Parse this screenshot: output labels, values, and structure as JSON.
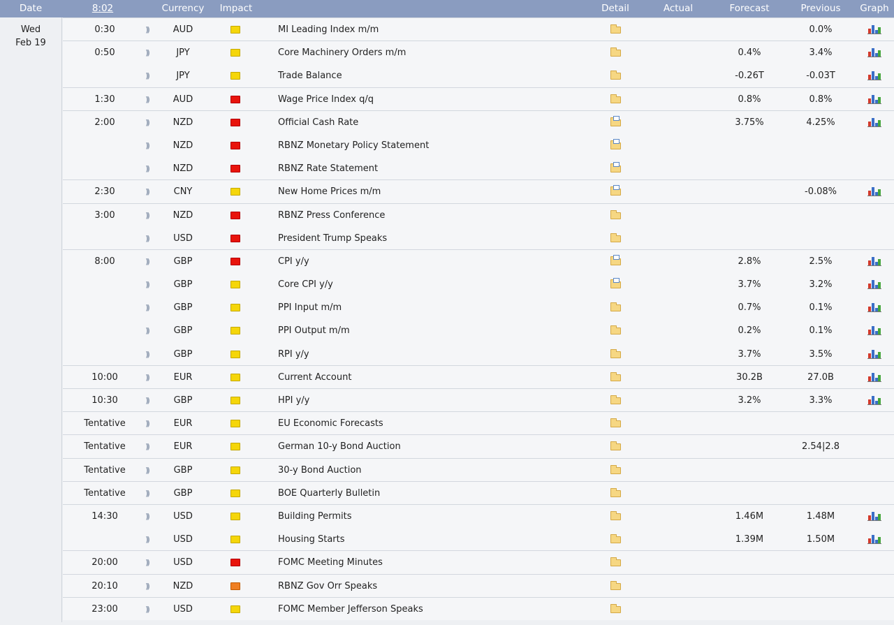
{
  "header": {
    "date": "Date",
    "clock": "8:02",
    "currency": "Currency",
    "impact": "Impact",
    "detail": "Detail",
    "actual": "Actual",
    "forecast": "Forecast",
    "previous": "Previous",
    "graph": "Graph"
  },
  "date": {
    "day": "Wed",
    "date": "Feb 19"
  },
  "impact_colors": {
    "high": "#e8140c",
    "medium": "#ef7f22",
    "low": "#f5d60a"
  },
  "events": [
    {
      "time": "0:30",
      "currency": "AUD",
      "impact": "low",
      "event": "MI Leading Index m/m",
      "detail_icon": "folder-icon",
      "actual": "",
      "forecast": "",
      "previous": "0.0%",
      "graph": true,
      "group_start": true
    },
    {
      "time": "0:50",
      "currency": "JPY",
      "impact": "low",
      "event": "Core Machinery Orders m/m",
      "detail_icon": "folder-icon",
      "actual": "",
      "forecast": "0.4%",
      "previous": "3.4%",
      "graph": true,
      "group_start": true
    },
    {
      "time": "",
      "currency": "JPY",
      "impact": "low",
      "event": "Trade Balance",
      "detail_icon": "folder-icon",
      "actual": "",
      "forecast": "-0.26T",
      "previous": "-0.03T",
      "graph": true,
      "group_start": false
    },
    {
      "time": "1:30",
      "currency": "AUD",
      "impact": "high",
      "event": "Wage Price Index q/q",
      "detail_icon": "folder-icon",
      "actual": "",
      "forecast": "0.8%",
      "previous": "0.8%",
      "graph": true,
      "group_start": true
    },
    {
      "time": "2:00",
      "currency": "NZD",
      "impact": "high",
      "event": "Official Cash Rate",
      "detail_icon": "news-folder-icon",
      "actual": "",
      "forecast": "3.75%",
      "previous": "4.25%",
      "graph": true,
      "group_start": true
    },
    {
      "time": "",
      "currency": "NZD",
      "impact": "high",
      "event": "RBNZ Monetary Policy Statement",
      "detail_icon": "news-folder-icon",
      "actual": "",
      "forecast": "",
      "previous": "",
      "graph": false,
      "group_start": false
    },
    {
      "time": "",
      "currency": "NZD",
      "impact": "high",
      "event": "RBNZ Rate Statement",
      "detail_icon": "news-folder-icon",
      "actual": "",
      "forecast": "",
      "previous": "",
      "graph": false,
      "group_start": false
    },
    {
      "time": "2:30",
      "currency": "CNY",
      "impact": "low",
      "event": "New Home Prices m/m",
      "detail_icon": "news-folder-icon",
      "actual": "",
      "forecast": "",
      "previous": "-0.08%",
      "graph": true,
      "group_start": true
    },
    {
      "time": "3:00",
      "currency": "NZD",
      "impact": "high",
      "event": "RBNZ Press Conference",
      "detail_icon": "folder-icon",
      "actual": "",
      "forecast": "",
      "previous": "",
      "graph": false,
      "group_start": true
    },
    {
      "time": "",
      "currency": "USD",
      "impact": "high",
      "event": "President Trump Speaks",
      "detail_icon": "folder-icon",
      "actual": "",
      "forecast": "",
      "previous": "",
      "graph": false,
      "group_start": false
    },
    {
      "time": "8:00",
      "currency": "GBP",
      "impact": "high",
      "event": "CPI y/y",
      "detail_icon": "news-folder-icon",
      "actual": "",
      "forecast": "2.8%",
      "previous": "2.5%",
      "graph": true,
      "group_start": true
    },
    {
      "time": "",
      "currency": "GBP",
      "impact": "low",
      "event": "Core CPI y/y",
      "detail_icon": "news-folder-icon",
      "actual": "",
      "forecast": "3.7%",
      "previous": "3.2%",
      "graph": true,
      "group_start": false
    },
    {
      "time": "",
      "currency": "GBP",
      "impact": "low",
      "event": "PPI Input m/m",
      "detail_icon": "folder-icon",
      "actual": "",
      "forecast": "0.7%",
      "previous": "0.1%",
      "graph": true,
      "group_start": false
    },
    {
      "time": "",
      "currency": "GBP",
      "impact": "low",
      "event": "PPI Output m/m",
      "detail_icon": "folder-icon",
      "actual": "",
      "forecast": "0.2%",
      "previous": "0.1%",
      "graph": true,
      "group_start": false
    },
    {
      "time": "",
      "currency": "GBP",
      "impact": "low",
      "event": "RPI y/y",
      "detail_icon": "folder-icon",
      "actual": "",
      "forecast": "3.7%",
      "previous": "3.5%",
      "graph": true,
      "group_start": false
    },
    {
      "time": "10:00",
      "currency": "EUR",
      "impact": "low",
      "event": "Current Account",
      "detail_icon": "folder-icon",
      "actual": "",
      "forecast": "30.2B",
      "previous": "27.0B",
      "graph": true,
      "group_start": true
    },
    {
      "time": "10:30",
      "currency": "GBP",
      "impact": "low",
      "event": "HPI y/y",
      "detail_icon": "folder-icon",
      "actual": "",
      "forecast": "3.2%",
      "previous": "3.3%",
      "graph": true,
      "group_start": true
    },
    {
      "time": "Tentative",
      "currency": "EUR",
      "impact": "low",
      "event": "EU Economic Forecasts",
      "detail_icon": "folder-icon",
      "actual": "",
      "forecast": "",
      "previous": "",
      "graph": false,
      "group_start": true
    },
    {
      "time": "Tentative",
      "currency": "EUR",
      "impact": "low",
      "event": "German 10-y Bond Auction",
      "detail_icon": "folder-icon",
      "actual": "",
      "forecast": "",
      "previous": "2.54|2.8",
      "graph": false,
      "group_start": true
    },
    {
      "time": "Tentative",
      "currency": "GBP",
      "impact": "low",
      "event": "30-y Bond Auction",
      "detail_icon": "folder-icon",
      "actual": "",
      "forecast": "",
      "previous": "",
      "graph": false,
      "group_start": true
    },
    {
      "time": "Tentative",
      "currency": "GBP",
      "impact": "low",
      "event": "BOE Quarterly Bulletin",
      "detail_icon": "folder-icon",
      "actual": "",
      "forecast": "",
      "previous": "",
      "graph": false,
      "group_start": true
    },
    {
      "time": "14:30",
      "currency": "USD",
      "impact": "low",
      "event": "Building Permits",
      "detail_icon": "folder-icon",
      "actual": "",
      "forecast": "1.46M",
      "previous": "1.48M",
      "graph": true,
      "group_start": true
    },
    {
      "time": "",
      "currency": "USD",
      "impact": "low",
      "event": "Housing Starts",
      "detail_icon": "folder-icon",
      "actual": "",
      "forecast": "1.39M",
      "previous": "1.50M",
      "graph": true,
      "group_start": false
    },
    {
      "time": "20:00",
      "currency": "USD",
      "impact": "high",
      "event": "FOMC Meeting Minutes",
      "detail_icon": "folder-icon",
      "actual": "",
      "forecast": "",
      "previous": "",
      "graph": false,
      "group_start": true
    },
    {
      "time": "20:10",
      "currency": "NZD",
      "impact": "medium",
      "event": "RBNZ Gov Orr Speaks",
      "detail_icon": "folder-icon",
      "actual": "",
      "forecast": "",
      "previous": "",
      "graph": false,
      "group_start": true
    },
    {
      "time": "23:00",
      "currency": "USD",
      "impact": "low",
      "event": "FOMC Member Jefferson Speaks",
      "detail_icon": "folder-icon",
      "actual": "",
      "forecast": "",
      "previous": "",
      "graph": false,
      "group_start": true
    }
  ]
}
